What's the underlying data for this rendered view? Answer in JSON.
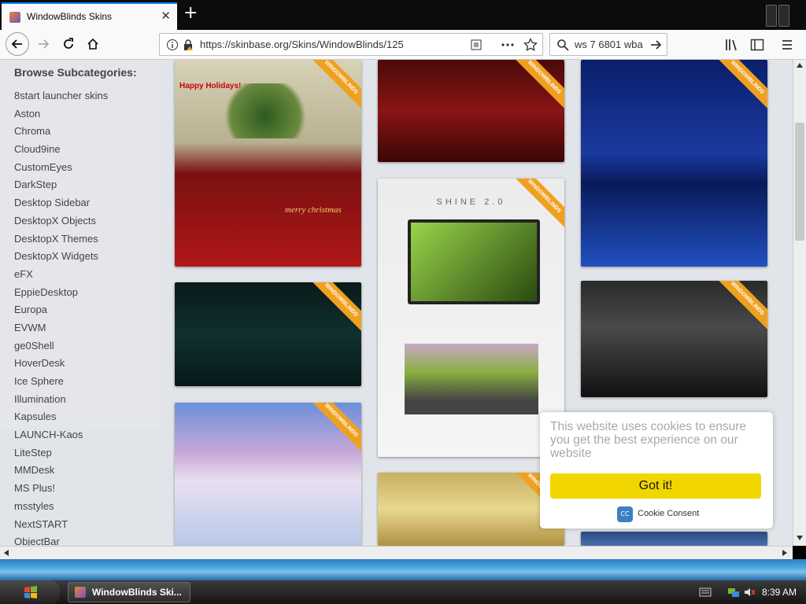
{
  "browser": {
    "tab_title": "WindowBlinds Skins",
    "tab_close": "✕",
    "new_tab": "+",
    "url": "https://skinbase.org/Skins/WindowBlinds/125",
    "search_value": "ws 7 6801 wba",
    "icons": [
      "back-icon",
      "forward-icon",
      "reload-icon",
      "home-icon",
      "info-icon",
      "lock-icon",
      "reader-icon",
      "more-icon",
      "bookmark-icon",
      "search-icon",
      "arrow-right-icon",
      "library-icon",
      "sidebar-icon",
      "menu-icon"
    ]
  },
  "sidebar": {
    "title": "Browse Subcategories:",
    "items": [
      {
        "label": "8start launcher skins"
      },
      {
        "label": "Aston"
      },
      {
        "label": "Chroma"
      },
      {
        "label": "Cloud9ine"
      },
      {
        "label": "CustomEyes"
      },
      {
        "label": "DarkStep"
      },
      {
        "label": "Desktop Sidebar"
      },
      {
        "label": "DesktopX Objects"
      },
      {
        "label": "DesktopX Themes"
      },
      {
        "label": "DesktopX Widgets"
      },
      {
        "label": "eFX"
      },
      {
        "label": "EppieDesktop"
      },
      {
        "label": "Europa"
      },
      {
        "label": "EVWM"
      },
      {
        "label": "ge0Shell"
      },
      {
        "label": "HoverDesk"
      },
      {
        "label": "Ice Sphere"
      },
      {
        "label": "Illumination"
      },
      {
        "label": "Kapsules"
      },
      {
        "label": "LAUNCH-Kaos"
      },
      {
        "label": "LiteStep"
      },
      {
        "label": "MMDesk"
      },
      {
        "label": "MS Plus!"
      },
      {
        "label": "msstyles"
      },
      {
        "label": "NextSTART"
      },
      {
        "label": "ObjectBar"
      }
    ]
  },
  "gallery": {
    "ribbon_label": "WINDOWBLINDS",
    "thumbs": [
      {
        "caption": "Happy Holidays!"
      },
      {
        "caption": "merry christmas"
      },
      {
        "caption": "SHINE 2.0"
      }
    ]
  },
  "cookie": {
    "message": "This website uses cookies to ensure you get the best experience on our website",
    "button": "Got it!",
    "logo": "CC",
    "link": "Cookie Consent",
    "colors": {
      "button": "#f1d600",
      "text": "#a9a9a9"
    }
  },
  "taskbar": {
    "task_label": "WindowBlinds Ski...",
    "clock": "8:39 AM"
  },
  "colors": {
    "accent": "#0a84ff",
    "ribbon": "#f0a020"
  }
}
